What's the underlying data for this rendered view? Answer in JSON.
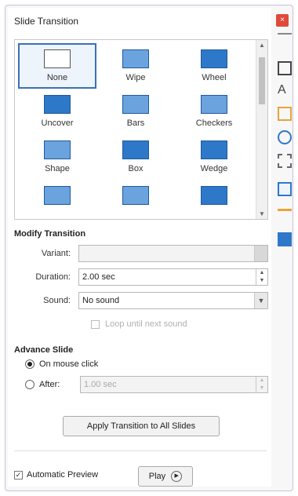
{
  "window": {
    "title": "Slide Transition",
    "close_glyph": "×"
  },
  "gallery": {
    "items": [
      {
        "label": "None",
        "icon": "none-icon",
        "selected": true
      },
      {
        "label": "Wipe",
        "icon": "wipe-icon"
      },
      {
        "label": "Wheel",
        "icon": "wheel-icon"
      },
      {
        "label": "Uncover",
        "icon": "uncover-icon"
      },
      {
        "label": "Bars",
        "icon": "bars-icon"
      },
      {
        "label": "Checkers",
        "icon": "checkers-icon"
      },
      {
        "label": "Shape",
        "icon": "shape-icon"
      },
      {
        "label": "Box",
        "icon": "box-icon"
      },
      {
        "label": "Wedge",
        "icon": "wedge-icon"
      },
      {
        "label": "",
        "icon": "venetian-icon"
      },
      {
        "label": "",
        "icon": "iris-icon"
      },
      {
        "label": "",
        "icon": "fade-icon"
      }
    ]
  },
  "modify": {
    "heading": "Modify Transition",
    "variant_label": "Variant:",
    "variant_value": "",
    "duration_label": "Duration:",
    "duration_value": "2.00 sec",
    "sound_label": "Sound:",
    "sound_value": "No sound",
    "loop_label": "Loop until next sound"
  },
  "advance": {
    "heading": "Advance Slide",
    "on_click_label": "On mouse click",
    "after_label": "After:",
    "after_value": "1.00 sec"
  },
  "apply_all_label": "Apply Transition to All Slides",
  "footer": {
    "auto_preview_label": "Automatic Preview",
    "play_label": "Play"
  },
  "colors": {
    "accent": "#3a70b8",
    "icon_blue": "#2d78c8",
    "close": "#e04a3a"
  }
}
